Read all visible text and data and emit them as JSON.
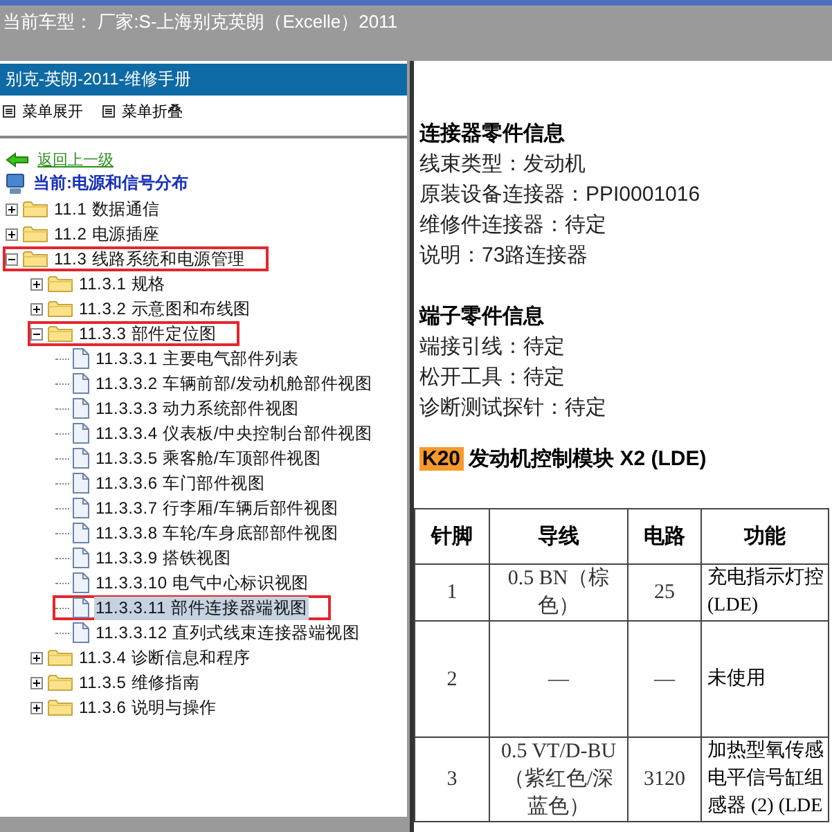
{
  "header": {
    "title": "当前车型： 厂家:S-上海别克英朗（Excelle）2011"
  },
  "sidebar": {
    "title": "别克-英朗-2011-维修手册",
    "menu": [
      "菜单展开",
      "菜单折叠"
    ],
    "back_link": "返回上一级",
    "current": "当前:电源和信号分布",
    "tree": [
      {
        "label": "11.1 数据通信",
        "kind": "folder",
        "expanded": false,
        "highlighted": false,
        "selected": false
      },
      {
        "label": "11.2 电源插座",
        "kind": "folder",
        "expanded": false,
        "highlighted": false,
        "selected": false
      },
      {
        "label": "11.3 线路系统和电源管理",
        "kind": "folder",
        "expanded": true,
        "highlighted": true,
        "selected": false,
        "children": [
          {
            "label": "11.3.1 规格",
            "kind": "folder",
            "expanded": false,
            "highlighted": false,
            "selected": false
          },
          {
            "label": "11.3.2 示意图和布线图",
            "kind": "folder",
            "expanded": false,
            "highlighted": false,
            "selected": false
          },
          {
            "label": "11.3.3 部件定位图",
            "kind": "folder",
            "expanded": true,
            "highlighted": true,
            "selected": false,
            "children": [
              {
                "label": "11.3.3.1 主要电气部件列表",
                "kind": "page",
                "highlighted": false,
                "selected": false
              },
              {
                "label": "11.3.3.2 车辆前部/发动机舱部件视图",
                "kind": "page",
                "highlighted": false,
                "selected": false
              },
              {
                "label": "11.3.3.3 动力系统部件视图",
                "kind": "page",
                "highlighted": false,
                "selected": false
              },
              {
                "label": "11.3.3.4 仪表板/中央控制台部件视图",
                "kind": "page",
                "highlighted": false,
                "selected": false
              },
              {
                "label": "11.3.3.5 乘客舱/车顶部件视图",
                "kind": "page",
                "highlighted": false,
                "selected": false
              },
              {
                "label": "11.3.3.6 车门部件视图",
                "kind": "page",
                "highlighted": false,
                "selected": false
              },
              {
                "label": "11.3.3.7 行李厢/车辆后部件视图",
                "kind": "page",
                "highlighted": false,
                "selected": false
              },
              {
                "label": "11.3.3.8 车轮/车身底部部件视图",
                "kind": "page",
                "highlighted": false,
                "selected": false
              },
              {
                "label": "11.3.3.9 搭铁视图",
                "kind": "page",
                "highlighted": false,
                "selected": false
              },
              {
                "label": "11.3.3.10 电气中心标识视图",
                "kind": "page",
                "highlighted": false,
                "selected": false
              },
              {
                "label": "11.3.3.11 部件连接器端视图",
                "kind": "page",
                "highlighted": true,
                "selected": true
              },
              {
                "label": "11.3.3.12 直列式线束连接器端视图",
                "kind": "page",
                "highlighted": false,
                "selected": false
              }
            ]
          },
          {
            "label": "11.3.4 诊断信息和程序",
            "kind": "folder",
            "expanded": false,
            "highlighted": false,
            "selected": false
          },
          {
            "label": "11.3.5 维修指南",
            "kind": "folder",
            "expanded": false,
            "highlighted": false,
            "selected": false
          },
          {
            "label": "11.3.6 说明与操作",
            "kind": "folder",
            "expanded": false,
            "highlighted": false,
            "selected": false
          }
        ]
      }
    ]
  },
  "content": {
    "sections": [
      {
        "title": "连接器零件信息",
        "lines": [
          "线束类型：发动机",
          "原装设备连接器：PPI0001016",
          "维修件连接器：待定",
          "说明：73路连接器"
        ]
      },
      {
        "title": "端子零件信息",
        "lines": [
          "端接引线：待定",
          "松开工具：待定",
          "诊断测试探针：待定"
        ]
      }
    ],
    "component": {
      "code": "K20",
      "name": "发动机控制模块 X2 (LDE)"
    },
    "table": {
      "columns": [
        "针脚",
        "导线",
        "电路",
        "功能"
      ],
      "rows": [
        {
          "pin": "1",
          "wire": "0.5 BN（棕色）",
          "circuit": "25",
          "function": [
            "充电指示灯控",
            "(LDE)"
          ]
        },
        {
          "pin": "2",
          "wire": "—",
          "circuit": "—",
          "function": [
            "未使用"
          ]
        },
        {
          "pin": "3",
          "wire": "0.5 VT/D-BU（紫红色/深蓝色）",
          "circuit": "3120",
          "function": [
            "加热型氧传感",
            "电平信号缸组",
            "感器 (2) (LDE"
          ]
        }
      ]
    }
  }
}
